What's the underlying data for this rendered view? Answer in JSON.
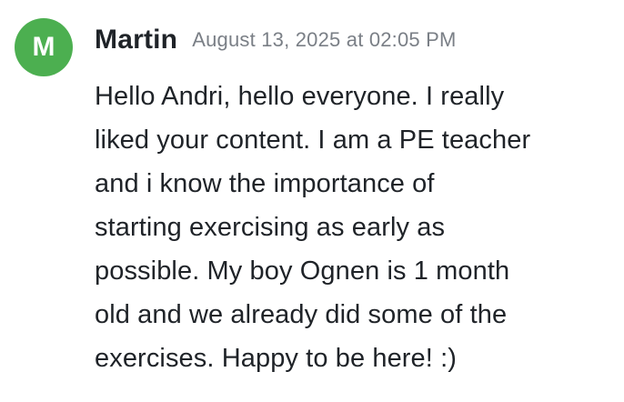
{
  "comment": {
    "avatar_initial": "M",
    "avatar_color": "#4caf50",
    "author": "Martin",
    "timestamp": "August 13, 2025 at 02:05 PM",
    "body_lines": [
      "Hello Andri, hello everyone. I really",
      "liked your content. I am a PE teacher",
      "and i know the importance of",
      "starting exercising as early as",
      "possible. My boy Ognen is 1 month",
      "old and we already did some of the",
      "exercises. Happy to be here! :)"
    ]
  }
}
